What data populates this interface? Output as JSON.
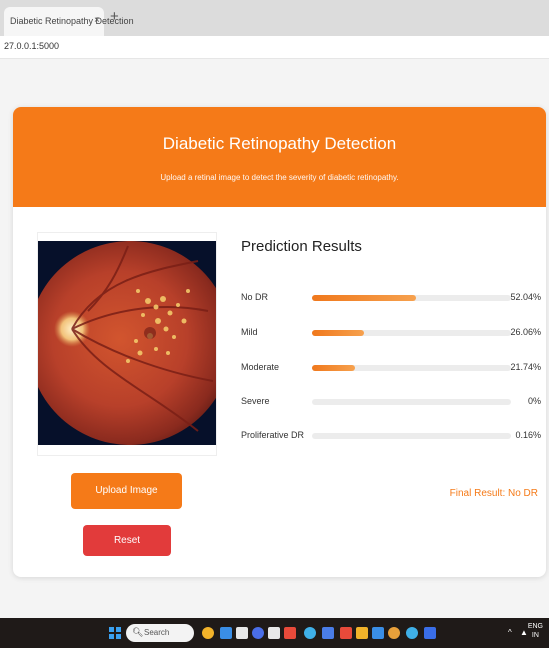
{
  "browser": {
    "tab_title": "Diabetic Retinopathy Detection",
    "tab_close": "×",
    "new_tab": "+",
    "url": "27.0.0.1:5000"
  },
  "header": {
    "title": "Diabetic Retinopathy Detection",
    "subtitle": "Upload a retinal image to detect the severity of diabetic retinopathy."
  },
  "buttons": {
    "upload": "Upload Image",
    "reset": "Reset"
  },
  "results": {
    "title": "Prediction Results",
    "items": [
      {
        "label": "No DR",
        "value": "52.04%",
        "fraction": 0.5204
      },
      {
        "label": "Mild",
        "value": "26.06%",
        "fraction": 0.2606
      },
      {
        "label": "Moderate",
        "value": "21.74%",
        "fraction": 0.2174
      },
      {
        "label": "Severe",
        "value": "0%",
        "fraction": 0
      },
      {
        "label": "Proliferative DR",
        "value": "0.16%",
        "fraction": 0.0016
      }
    ],
    "final": "Final Result: No DR"
  },
  "taskbar": {
    "search_placeholder": "Search",
    "lang_line1": "ENG",
    "lang_line2": "IN"
  }
}
